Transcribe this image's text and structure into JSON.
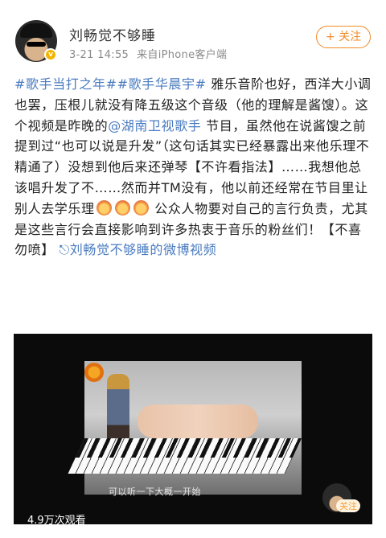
{
  "header": {
    "username": "刘畅觉不够睡",
    "time": "3-21 14:55",
    "source": "来自iPhone客户端",
    "follow_label": "+ 关注"
  },
  "post": {
    "tag1": "#歌手当打之年#",
    "tag2": "#歌手华晨宇#",
    "text1": " 雅乐音阶也好，西洋大小调也罢，压根儿就没有降五级这个音级（他的理解是酱馊）。这个视频是昨晚的",
    "mention": "@湖南卫视歌手",
    "text2": " 节目，虽然他在说酱馊之前提到过“也可以说是升发”（这句话其实已经暴露出来他乐理不精通了）没想到他后来还弹琴【不许看指法】……我想他总该唱升发了不……然而并TM没有，他以前还经常在节目里让别人去学乐理",
    "text3": " 公众人物要对自己的言行负责，尤其是这些言行会直接影响到许多热衷于音乐的粉丝们！【不喜勿喷】",
    "video_link": "刘畅觉不够睡的微博视频"
  },
  "video": {
    "subtitle": "可以听一下大概一开始",
    "views": "4.9万次观看",
    "mini_follow": "关注"
  },
  "colors": {
    "accent": "#f08a2a",
    "link": "#4a7bc0"
  },
  "icons": [
    "user-avatar",
    "verified-badge",
    "laugh-emoji",
    "video-link-icon",
    "mango-tv-logo"
  ]
}
